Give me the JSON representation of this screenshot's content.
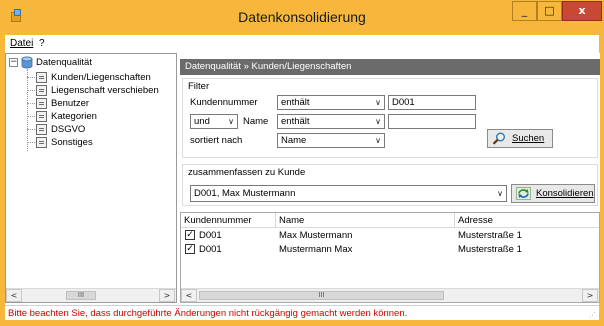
{
  "window": {
    "title": "Datenkonsolidierung",
    "controls": {
      "minimize": "_",
      "maximize": "□",
      "close": "x"
    },
    "colors": {
      "frame": "#f6b73c",
      "close": "#c74934",
      "header": "#6b6b6b",
      "status_text": "#d00000"
    }
  },
  "menu": {
    "items": [
      "Datei",
      "?"
    ]
  },
  "tree": {
    "root": "Datenqualität",
    "items": [
      "Kunden/Liegenschaften",
      "Liegenschaft verschieben",
      "Benutzer",
      "Kategorien",
      "DSGVO",
      "Sonstiges"
    ],
    "expander": "−",
    "scroll": {
      "left": "<",
      "thumb": "III",
      "right": ">"
    }
  },
  "panel": {
    "breadcrumb": "Datenqualität » Kunden/Liegenschaften",
    "filter": {
      "title": "Filter",
      "row1": {
        "label": "Kundennummer",
        "operator": "enthält",
        "value": "D001"
      },
      "row2": {
        "conjunction": "und",
        "label": "Name",
        "operator": "enthält",
        "value": ""
      },
      "row3": {
        "label": "sortiert nach",
        "sort_by": "Name"
      },
      "search_button": "Suchen"
    },
    "merge": {
      "title": "zusammenfassen zu Kunde",
      "target": "D001, Max Mustermann",
      "consolidate_button": "Konsolidieren"
    },
    "table": {
      "columns": [
        "Kundennummer",
        "Name",
        "Adresse"
      ],
      "rows": [
        {
          "checked": true,
          "number": "D001",
          "name": "Max Mustermann",
          "address": "Musterstraße 1"
        },
        {
          "checked": true,
          "number": "D001",
          "name": "Mustermann Max",
          "address": "Musterstraße 1"
        }
      ],
      "scroll": {
        "left": "<",
        "thumb": "III",
        "right": ">"
      }
    }
  },
  "status": {
    "message": "Bitte beachten Sie, dass durchgeführte Änderungen nicht rückgängig gemacht werden können."
  },
  "icons": {
    "search": "magnifier-icon",
    "consolidate": "refresh-icon",
    "tree_root": "database-icon",
    "tree_item": "document-icon"
  }
}
